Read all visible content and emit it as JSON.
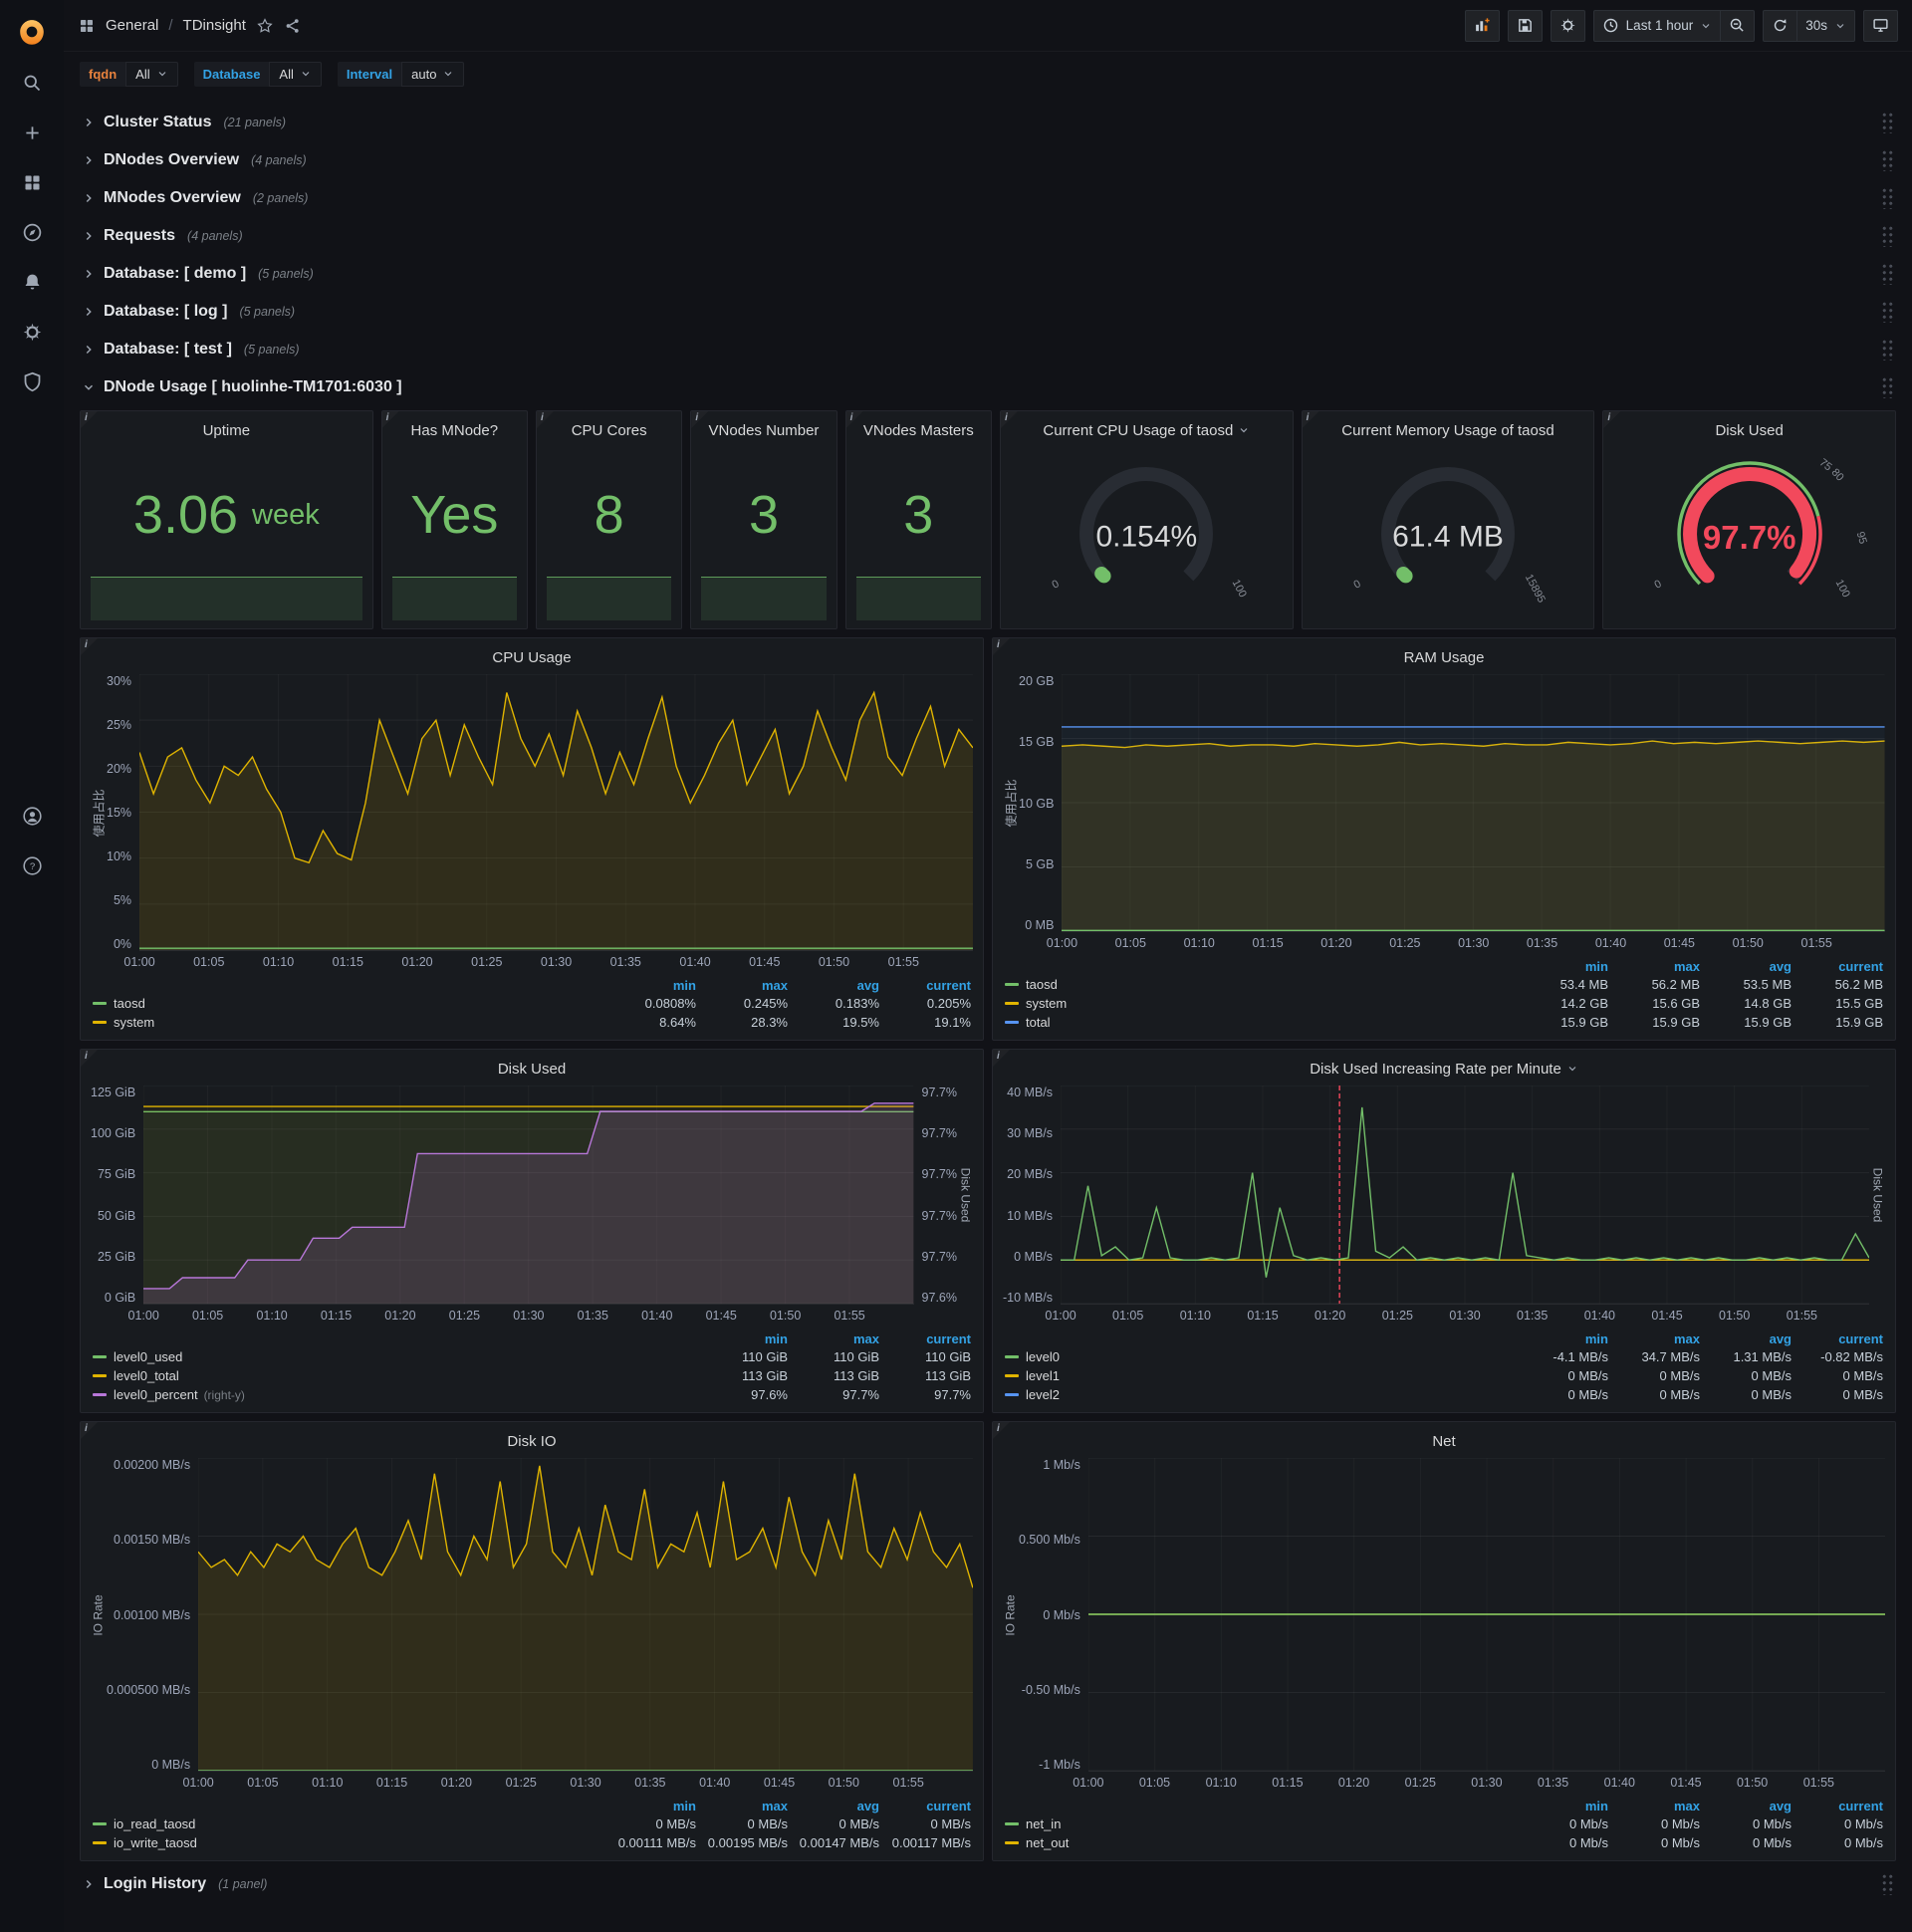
{
  "colors": {
    "green": "#73bf69",
    "yellow": "#e0b400",
    "blue": "#5794f2",
    "red": "#f2495c",
    "purple": "#b877d9",
    "accent_orange": "#eb7b18",
    "legend_header": "#33a2e5"
  },
  "topbar": {
    "breadcrumb": {
      "section": "General",
      "separator": "/",
      "title": "TDinsight"
    },
    "time_range": "Last 1 hour",
    "refresh_interval": "30s"
  },
  "variables": [
    {
      "label": "fqdn",
      "label_color": "#e8823d",
      "value": "All"
    },
    {
      "label": "Database",
      "label_color": "#33a2e5",
      "value": "All"
    },
    {
      "label": "Interval",
      "label_color": "#33a2e5",
      "value": "auto"
    }
  ],
  "collapsed_rows": [
    {
      "title": "Cluster Status",
      "count": "(21 panels)"
    },
    {
      "title": "DNodes Overview",
      "count": "(4 panels)"
    },
    {
      "title": "MNodes Overview",
      "count": "(2 panels)"
    },
    {
      "title": "Requests",
      "count": "(4 panels)"
    },
    {
      "title": "Database: [ demo ]",
      "count": "(5 panels)"
    },
    {
      "title": "Database: [ log ]",
      "count": "(5 panels)"
    },
    {
      "title": "Database: [ test ]",
      "count": "(5 panels)"
    }
  ],
  "expanded_row": {
    "title": "DNode Usage [ huolinhe-TM1701:6030 ]"
  },
  "bottom_row": {
    "title": "Login History",
    "count": "(1 panel)"
  },
  "stats": [
    {
      "title": "Uptime",
      "value": "3.06",
      "unit": "week"
    },
    {
      "title": "Has MNode?",
      "value": "Yes",
      "unit": ""
    },
    {
      "title": "CPU Cores",
      "value": "8",
      "unit": ""
    },
    {
      "title": "VNodes Number",
      "value": "3",
      "unit": ""
    },
    {
      "title": "VNodes Masters",
      "value": "3",
      "unit": ""
    }
  ],
  "gauges": [
    {
      "title": "Current CPU Usage of taosd",
      "value": "0.154%",
      "min": "0",
      "max": "100",
      "fraction": 0.0015,
      "value_color": "#d8d9da",
      "arc_color": "#73bf69",
      "ring": false
    },
    {
      "title": "Current Memory Usage of taosd",
      "value": "61.4 MB",
      "min": "0",
      "max": "15895",
      "fraction": 0.0039,
      "value_color": "#d8d9da",
      "arc_color": "#73bf69",
      "ring": false
    },
    {
      "title": "Disk Used",
      "value": "97.7%",
      "min": "0",
      "max": "100",
      "fraction": 0.977,
      "value_color": "#f2495c",
      "arc_color": "#f2495c",
      "ring": true,
      "thresholds": {
        "t1": "75",
        "t2": "80",
        "t3": "95"
      }
    }
  ],
  "chart_data": [
    {
      "type": "line",
      "title": "CPU Usage",
      "ylabel": "使用占比",
      "yticks": [
        "30%",
        "25%",
        "20%",
        "15%",
        "10%",
        "5%",
        "0%"
      ],
      "ymin": 0,
      "ymax": 30,
      "xticks": [
        "01:00",
        "01:05",
        "01:10",
        "01:15",
        "01:20",
        "01:25",
        "01:30",
        "01:35",
        "01:40",
        "01:45",
        "01:50",
        "01:55"
      ],
      "series": [
        {
          "name": "system",
          "color": "#e0b400",
          "fill": 0.12,
          "values": [
            21.5,
            17,
            21,
            22,
            18.5,
            16,
            20,
            19,
            21,
            17.5,
            15,
            10,
            9.5,
            13,
            10.5,
            9.8,
            16,
            25,
            21,
            17,
            23,
            25,
            19,
            24.5,
            21,
            18,
            28,
            23,
            20,
            23.5,
            19,
            26,
            22,
            17,
            21.5,
            18,
            23,
            27.5,
            20,
            16,
            19,
            22.5,
            25,
            18,
            21,
            24,
            17,
            20,
            26,
            22,
            18.5,
            25,
            28,
            21,
            19,
            23,
            26.5,
            20,
            24,
            22
          ]
        },
        {
          "name": "taosd",
          "color": "#73bf69",
          "fill": 0.08,
          "values": [
            0.2,
            0.2
          ]
        }
      ],
      "legend": {
        "columns": [
          "min",
          "max",
          "avg",
          "current"
        ],
        "rows": [
          {
            "name": "taosd",
            "color": "#73bf69",
            "values": [
              "0.0808%",
              "0.245%",
              "0.183%",
              "0.205%"
            ]
          },
          {
            "name": "system",
            "color": "#e0b400",
            "values": [
              "8.64%",
              "28.3%",
              "19.5%",
              "19.1%"
            ]
          }
        ]
      }
    },
    {
      "type": "line",
      "title": "RAM Usage",
      "ylabel": "使用占比",
      "yticks": [
        "20 GB",
        "15 GB",
        "10 GB",
        "5 GB",
        "0 MB"
      ],
      "ymin": 0,
      "ymax": 20,
      "xticks": [
        "01:00",
        "01:05",
        "01:10",
        "01:15",
        "01:20",
        "01:25",
        "01:30",
        "01:35",
        "01:40",
        "01:45",
        "01:50",
        "01:55"
      ],
      "series": [
        {
          "name": "system",
          "color": "#e0b400",
          "fill": 0.12,
          "values": [
            14.4,
            14.5,
            14.4,
            14.3,
            14.5,
            14.4,
            14.5,
            14.6,
            14.4,
            14.5,
            14.5,
            14.4,
            14.6,
            14.5,
            14.4,
            14.5,
            14.7,
            14.5,
            14.6,
            14.5,
            14.4,
            14.6,
            14.5,
            14.5,
            14.7,
            14.6,
            14.5,
            14.6,
            14.8,
            14.6,
            14.7,
            14.6,
            14.7,
            14.8,
            14.7,
            14.6,
            14.7,
            14.8,
            14.7,
            14.8
          ]
        },
        {
          "name": "total",
          "color": "#5794f2",
          "fill": 0.05,
          "values": [
            15.9,
            15.9
          ]
        },
        {
          "name": "taosd",
          "color": "#73bf69",
          "fill": 0,
          "values": [
            0.055,
            0.055
          ]
        }
      ],
      "legend": {
        "columns": [
          "min",
          "max",
          "avg",
          "current"
        ],
        "rows": [
          {
            "name": "taosd",
            "color": "#73bf69",
            "values": [
              "53.4 MB",
              "56.2 MB",
              "53.5 MB",
              "56.2 MB"
            ]
          },
          {
            "name": "system",
            "color": "#e0b400",
            "values": [
              "14.2 GB",
              "15.6 GB",
              "14.8 GB",
              "15.5 GB"
            ]
          },
          {
            "name": "total",
            "color": "#5794f2",
            "values": [
              "15.9 GB",
              "15.9 GB",
              "15.9 GB",
              "15.9 GB"
            ]
          }
        ]
      }
    },
    {
      "type": "line",
      "title": "Disk Used",
      "ylabel_right": "Disk Used",
      "yticks": [
        "125 GiB",
        "100 GiB",
        "75 GiB",
        "50 GiB",
        "25 GiB",
        "0 GiB"
      ],
      "ymin": 0,
      "ymax": 125,
      "right": {
        "ticks": [
          "97.7%",
          "97.7%",
          "97.7%",
          "97.7%",
          "97.7%",
          "97.6%"
        ],
        "min": 97.56,
        "max": 97.72
      },
      "xticks": [
        "01:00",
        "01:05",
        "01:10",
        "01:15",
        "01:20",
        "01:25",
        "01:30",
        "01:35",
        "01:40",
        "01:45",
        "01:50",
        "01:55"
      ],
      "series": [
        {
          "name": "level0_used",
          "color": "#73bf69",
          "fill": 0.07,
          "values": [
            110,
            110
          ]
        },
        {
          "name": "level0_total",
          "color": "#e0b400",
          "fill": 0.05,
          "values": [
            113,
            113
          ]
        },
        {
          "name": "level0_percent",
          "color": "#b877d9",
          "fill": 0.16,
          "axis": "right",
          "values": [
            97.571,
            97.571,
            97.571,
            97.579,
            97.579,
            97.579,
            97.579,
            97.579,
            97.592,
            97.592,
            97.592,
            97.592,
            97.592,
            97.608,
            97.608,
            97.608,
            97.616,
            97.616,
            97.616,
            97.616,
            97.616,
            97.67,
            97.67,
            97.67,
            97.67,
            97.67,
            97.67,
            97.67,
            97.67,
            97.67,
            97.67,
            97.67,
            97.67,
            97.67,
            97.67,
            97.701,
            97.701,
            97.701,
            97.701,
            97.701,
            97.701,
            97.701,
            97.701,
            97.701,
            97.701,
            97.701,
            97.701,
            97.701,
            97.701,
            97.701,
            97.701,
            97.701,
            97.701,
            97.701,
            97.701,
            97.701,
            97.707,
            97.707,
            97.707,
            97.707
          ]
        }
      ],
      "legend": {
        "columns": [
          "min",
          "max",
          "current"
        ],
        "rows": [
          {
            "name": "level0_used",
            "color": "#73bf69",
            "values": [
              "110 GiB",
              "110 GiB",
              "110 GiB"
            ]
          },
          {
            "name": "level0_total",
            "color": "#e0b400",
            "values": [
              "113 GiB",
              "113 GiB",
              "113 GiB"
            ]
          },
          {
            "name": "level0_percent",
            "color": "#b877d9",
            "note": "(right-y)",
            "values": [
              "97.6%",
              "97.7%",
              "97.7%"
            ]
          }
        ]
      }
    },
    {
      "type": "line",
      "title": "Disk Used Increasing Rate per Minute",
      "has_menu": true,
      "ylabel_right": "Disk Used",
      "yticks": [
        "40 MB/s",
        "30 MB/s",
        "20 MB/s",
        "10 MB/s",
        "0 MB/s",
        "-10 MB/s"
      ],
      "ymin": -10,
      "ymax": 40,
      "xticks": [
        "01:00",
        "01:05",
        "01:10",
        "01:15",
        "01:20",
        "01:25",
        "01:30",
        "01:35",
        "01:40",
        "01:45",
        "01:50",
        "01:55"
      ],
      "annotations": [
        {
          "x": 0.345,
          "color": "#f2495c"
        }
      ],
      "series": [
        {
          "name": "level2",
          "color": "#5794f2",
          "fill": 0,
          "values": [
            0,
            0
          ]
        },
        {
          "name": "level1",
          "color": "#e0b400",
          "fill": 0,
          "values": [
            0,
            0
          ]
        },
        {
          "name": "level0",
          "color": "#73bf69",
          "fill": 0,
          "values": [
            0,
            0,
            17,
            1,
            3,
            0,
            0.5,
            12,
            0.5,
            0,
            0,
            0.5,
            0,
            0.5,
            20,
            -4,
            12,
            1,
            0,
            0.5,
            0,
            0.5,
            35,
            2,
            0.5,
            3,
            0,
            0.5,
            0,
            0.5,
            0,
            0.5,
            0,
            20,
            1,
            0.5,
            0,
            0.5,
            0,
            0,
            0.5,
            0,
            0.5,
            0,
            0.5,
            0,
            0.5,
            0,
            0.5,
            0,
            0,
            0.5,
            0,
            0.5,
            0,
            0.5,
            0,
            0,
            6,
            0.5
          ]
        }
      ],
      "legend": {
        "columns": [
          "min",
          "max",
          "avg",
          "current"
        ],
        "rows": [
          {
            "name": "level0",
            "color": "#73bf69",
            "values": [
              "-4.1 MB/s",
              "34.7 MB/s",
              "1.31 MB/s",
              "-0.82 MB/s"
            ]
          },
          {
            "name": "level1",
            "color": "#e0b400",
            "values": [
              "0 MB/s",
              "0 MB/s",
              "0 MB/s",
              "0 MB/s"
            ]
          },
          {
            "name": "level2",
            "color": "#5794f2",
            "values": [
              "0 MB/s",
              "0 MB/s",
              "0 MB/s",
              "0 MB/s"
            ]
          }
        ]
      }
    },
    {
      "type": "line",
      "title": "Disk IO",
      "ylabel": "IO Rate",
      "yticks": [
        "0.00200 MB/s",
        "0.00150 MB/s",
        "0.00100 MB/s",
        "0.000500 MB/s",
        "0 MB/s"
      ],
      "ymin": 0,
      "ymax": 0.002,
      "xticks": [
        "01:00",
        "01:05",
        "01:10",
        "01:15",
        "01:20",
        "01:25",
        "01:30",
        "01:35",
        "01:40",
        "01:45",
        "01:50",
        "01:55"
      ],
      "series": [
        {
          "name": "io_write_taosd",
          "color": "#e0b400",
          "fill": 0.12,
          "values": [
            0.0014,
            0.0013,
            0.00135,
            0.00125,
            0.0014,
            0.0013,
            0.00145,
            0.0014,
            0.0015,
            0.00135,
            0.0013,
            0.00145,
            0.00155,
            0.0013,
            0.00125,
            0.0014,
            0.0016,
            0.00135,
            0.0019,
            0.0014,
            0.00125,
            0.0015,
            0.00135,
            0.00185,
            0.0013,
            0.00145,
            0.00195,
            0.0014,
            0.0013,
            0.00155,
            0.00125,
            0.0017,
            0.0014,
            0.00135,
            0.0018,
            0.0013,
            0.00145,
            0.0014,
            0.00165,
            0.0013,
            0.00185,
            0.00135,
            0.0014,
            0.00155,
            0.0013,
            0.00175,
            0.0014,
            0.00125,
            0.0016,
            0.00135,
            0.0019,
            0.0014,
            0.0013,
            0.00155,
            0.00135,
            0.00165,
            0.0014,
            0.0013,
            0.00145,
            0.00117
          ]
        },
        {
          "name": "io_read_taosd",
          "color": "#73bf69",
          "fill": 0,
          "values": [
            0,
            0
          ]
        }
      ],
      "legend": {
        "columns": [
          "min",
          "max",
          "avg",
          "current"
        ],
        "rows": [
          {
            "name": "io_read_taosd",
            "color": "#73bf69",
            "values": [
              "0 MB/s",
              "0 MB/s",
              "0 MB/s",
              "0 MB/s"
            ]
          },
          {
            "name": "io_write_taosd",
            "color": "#e0b400",
            "values": [
              "0.00111 MB/s",
              "0.00195 MB/s",
              "0.00147 MB/s",
              "0.00117 MB/s"
            ]
          }
        ]
      }
    },
    {
      "type": "line",
      "title": "Net",
      "ylabel": "IO Rate",
      "yticks": [
        "1 Mb/s",
        "0.500 Mb/s",
        "0 Mb/s",
        "-0.50 Mb/s",
        "-1 Mb/s"
      ],
      "ymin": -1,
      "ymax": 1,
      "xticks": [
        "01:00",
        "01:05",
        "01:10",
        "01:15",
        "01:20",
        "01:25",
        "01:30",
        "01:35",
        "01:40",
        "01:45",
        "01:50",
        "01:55"
      ],
      "series": [
        {
          "name": "net_out",
          "color": "#e0b400",
          "fill": 0,
          "values": [
            0,
            0
          ]
        },
        {
          "name": "net_in",
          "color": "#73bf69",
          "fill": 0,
          "values": [
            0,
            0
          ]
        }
      ],
      "legend": {
        "columns": [
          "min",
          "max",
          "avg",
          "current"
        ],
        "rows": [
          {
            "name": "net_in",
            "color": "#73bf69",
            "values": [
              "0 Mb/s",
              "0 Mb/s",
              "0 Mb/s",
              "0 Mb/s"
            ]
          },
          {
            "name": "net_out",
            "color": "#e0b400",
            "values": [
              "0 Mb/s",
              "0 Mb/s",
              "0 Mb/s",
              "0 Mb/s"
            ]
          }
        ]
      }
    }
  ]
}
